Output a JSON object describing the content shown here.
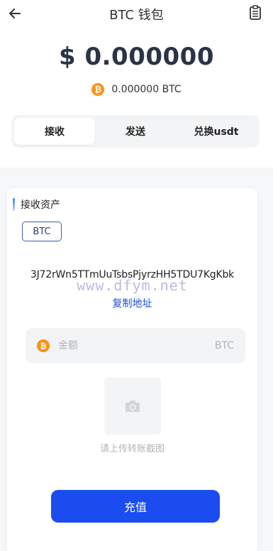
{
  "header": {
    "title": "BTC 钱包",
    "back_icon": "arrow-left-icon",
    "right_icon": "clipboard-icon"
  },
  "balance": {
    "fiat": "$ 0.000000",
    "crypto": "0.000000 BTC",
    "coin_symbol": "₿",
    "coin_color": "#f7931a"
  },
  "tabs": [
    {
      "label": "接收",
      "active": true
    },
    {
      "label": "发送",
      "active": false
    },
    {
      "label": "兑换usdt",
      "active": false
    }
  ],
  "receive": {
    "section_title": "接收资产",
    "network_chip": "BTC",
    "address": "3J72rWn5TTmUuTsbsPjyrzHH5TDU7KgKbk",
    "watermark": "www.dfym.net",
    "copy_label": "复制地址",
    "amount_placeholder": "金额",
    "amount_value": "",
    "amount_unit": "BTC",
    "upload_label": "请上传转账截图",
    "upload_icon": "camera-icon",
    "submit_label": "充值"
  },
  "colors": {
    "primary": "#1a4cf0",
    "link": "#1d4fd8",
    "bitcoin": "#f7931a"
  }
}
